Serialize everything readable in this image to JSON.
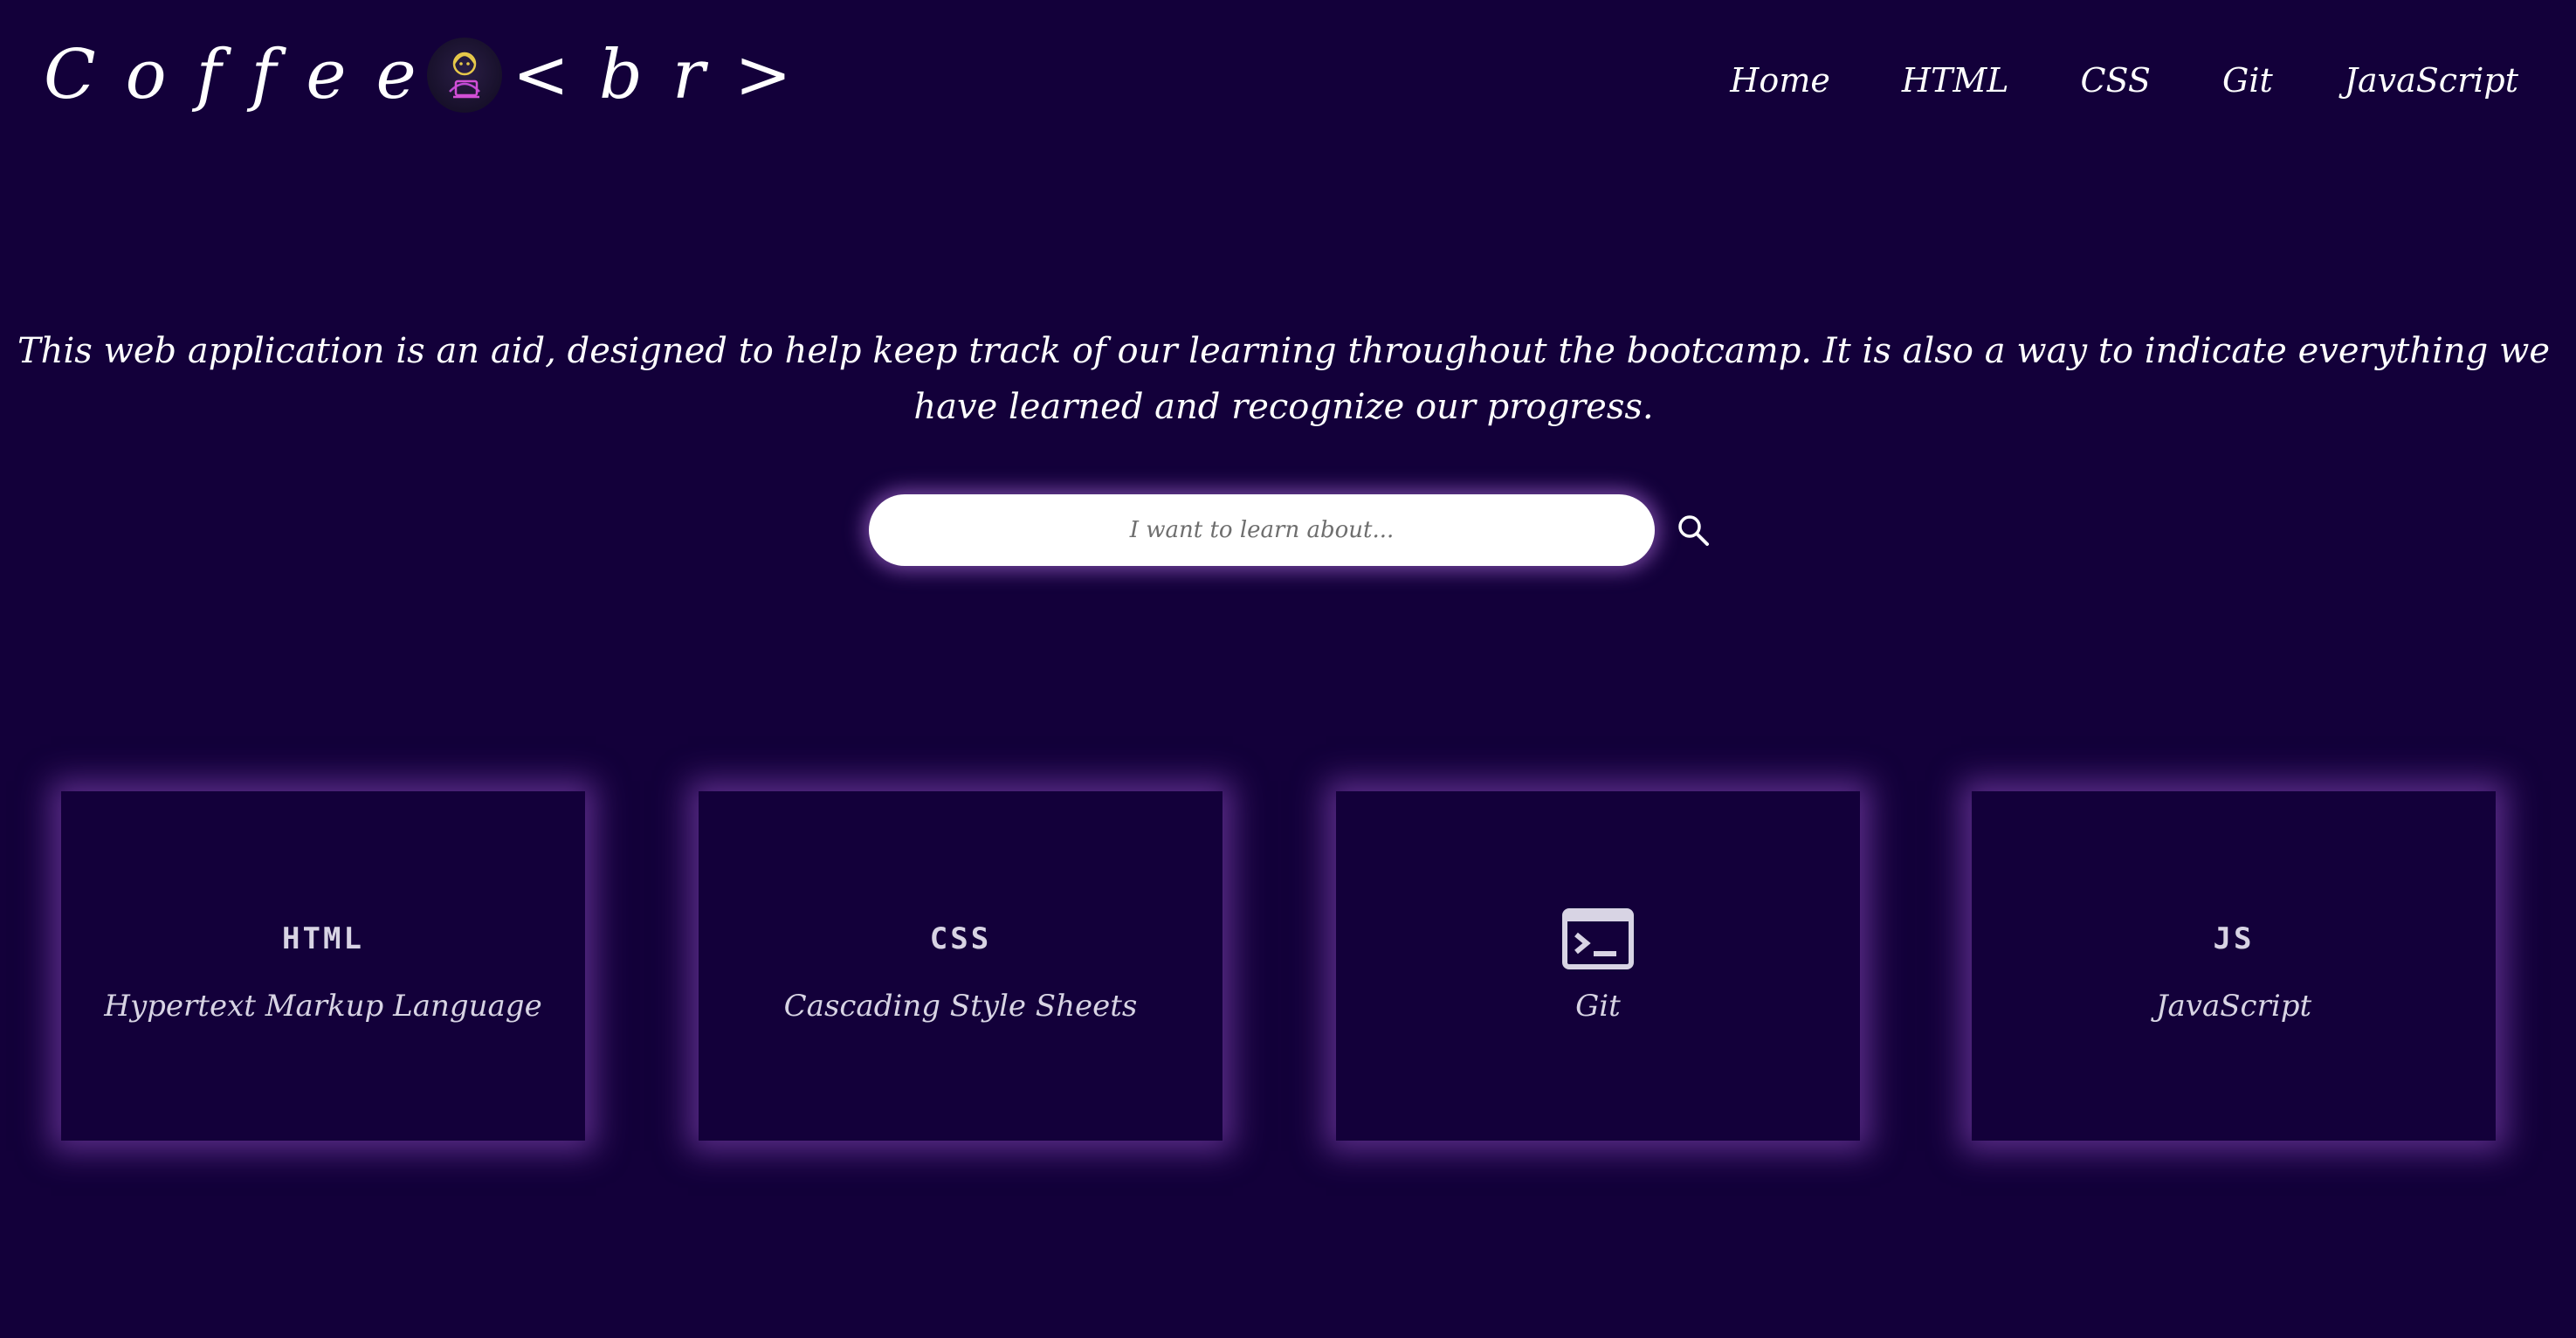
{
  "header": {
    "logo_left": "Coffee",
    "logo_right": "<br>",
    "nav": [
      "Home",
      "HTML",
      "CSS",
      "Git",
      "JavaScript"
    ]
  },
  "intro": {
    "text": "This web application is an aid, designed to help keep track of our learning throughout the bootcamp. It is also a way to indicate everything we have learned and recognize our progress."
  },
  "search": {
    "placeholder": "I want to learn about...",
    "value": ""
  },
  "cards": [
    {
      "icon": "html-icon",
      "icon_text": "HTML",
      "title": "Hypertext Markup Language"
    },
    {
      "icon": "css-icon",
      "icon_text": "CSS",
      "title": "Cascading Style Sheets"
    },
    {
      "icon": "terminal-icon",
      "icon_text": "",
      "title": "Git"
    },
    {
      "icon": "js-icon",
      "icon_text": "JS",
      "title": "JavaScript"
    }
  ],
  "colors": {
    "background": "#13003a",
    "glow": "#9650c8",
    "text": "#ffffff",
    "card_text": "#d8d4e4"
  }
}
